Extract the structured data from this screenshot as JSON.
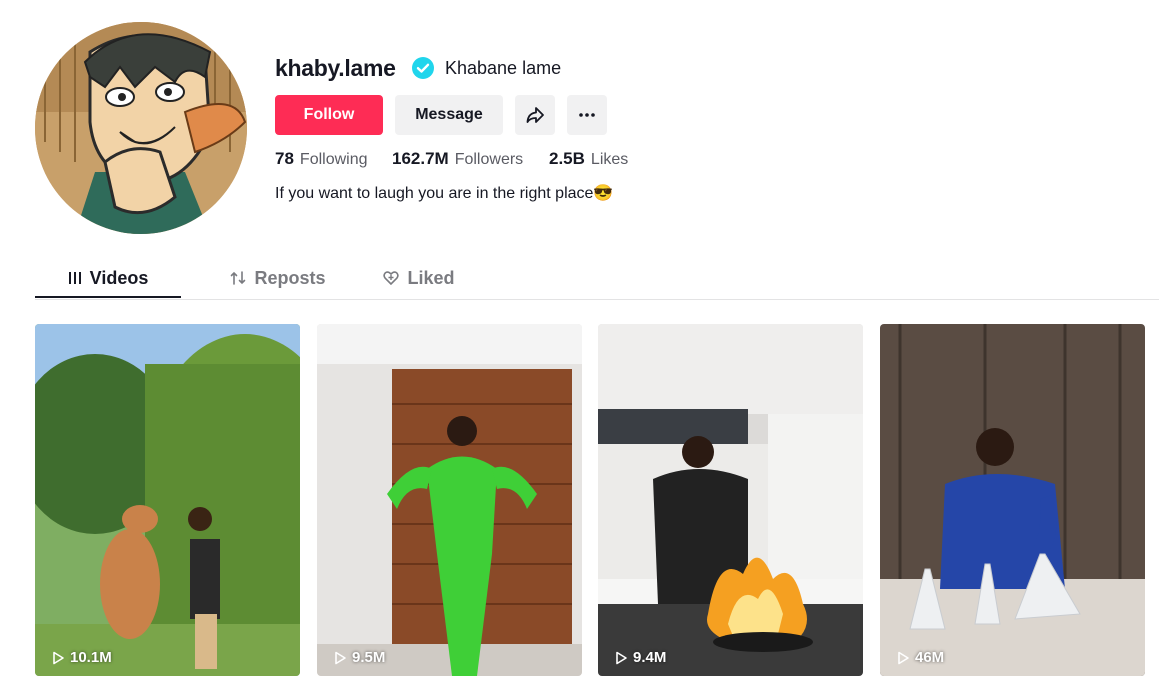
{
  "profile": {
    "username": "khaby.lame",
    "nickname": "Khabane lame",
    "verified": true,
    "bio": "If you want to laugh you are in the right place😎"
  },
  "actions": {
    "follow_label": "Follow",
    "message_label": "Message",
    "share_icon": "share-icon",
    "more_icon": "more-icon"
  },
  "stats": {
    "following_count": "78",
    "following_label": "Following",
    "followers_count": "162.7M",
    "followers_label": "Followers",
    "likes_count": "2.5B",
    "likes_label": "Likes"
  },
  "tabs": [
    {
      "label": "Videos",
      "icon": "grid-icon",
      "active": true
    },
    {
      "label": "Reposts",
      "icon": "repost-icon",
      "active": false
    },
    {
      "label": "Liked",
      "icon": "liked-heart-icon",
      "active": false
    }
  ],
  "videos": [
    {
      "views": "10.1M"
    },
    {
      "views": "9.5M"
    },
    {
      "views": "9.4M"
    },
    {
      "views": "46M"
    }
  ],
  "colors": {
    "accent": "#fe2c55",
    "verified": "#20d5ec",
    "text": "#161823",
    "muted": "#5a5b63"
  }
}
